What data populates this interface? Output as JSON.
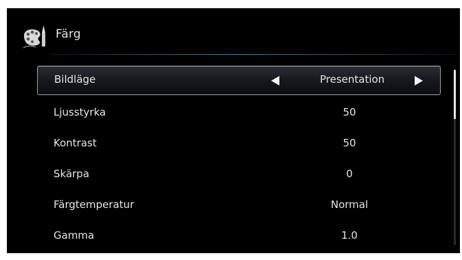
{
  "menu": {
    "title": "Färg",
    "icon": "palette-brush-icon",
    "items": [
      {
        "label": "Bildläge",
        "value": "Presentation",
        "selected": true
      },
      {
        "label": "Ljusstyrka",
        "value": "50"
      },
      {
        "label": "Kontrast",
        "value": "50"
      },
      {
        "label": "Skärpa",
        "value": "0"
      },
      {
        "label": "Färgtemperatur",
        "value": "Normal"
      },
      {
        "label": "Gamma",
        "value": "1.0"
      }
    ]
  },
  "colors": {
    "background": "#000000",
    "text": "#e6e6e6",
    "selection_border": "#9aa3ad",
    "header_line": "#50aae6"
  }
}
